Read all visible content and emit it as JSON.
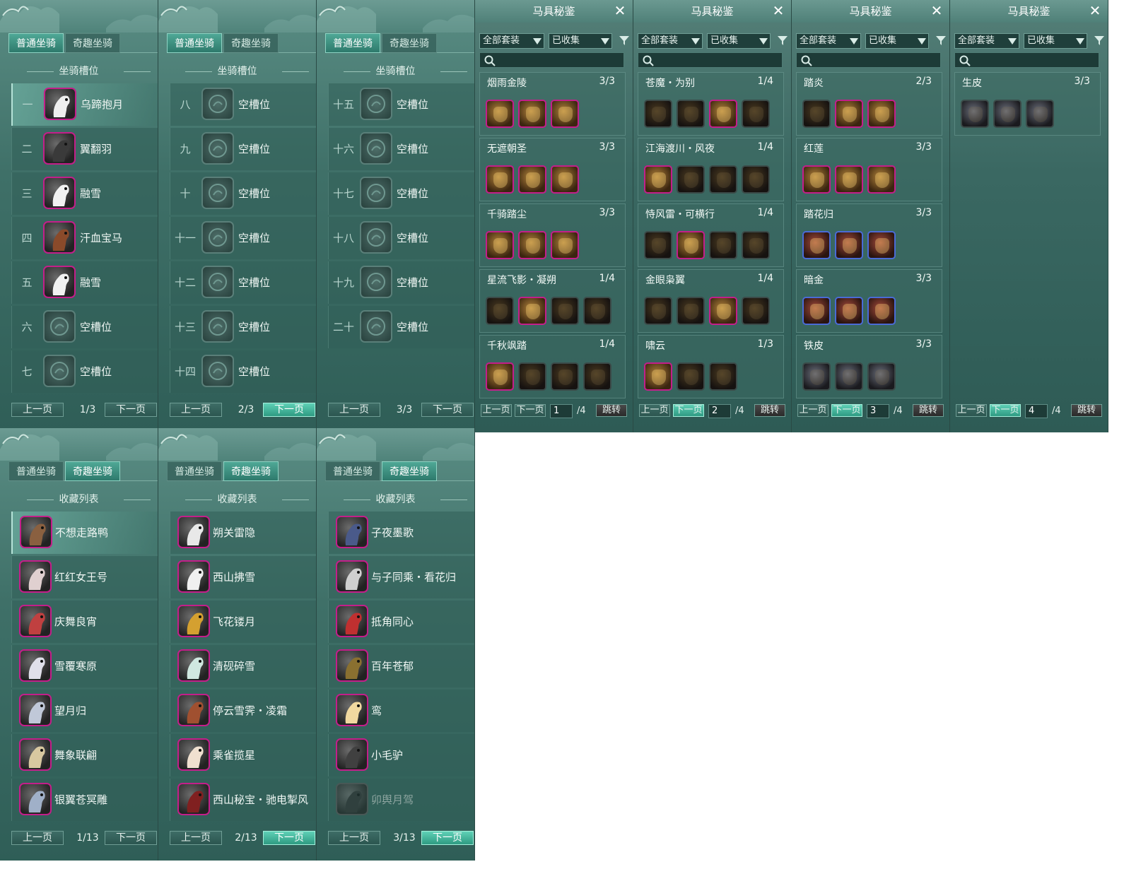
{
  "tabs": {
    "normal": "普通坐骑",
    "fun": "奇趣坐骑"
  },
  "slot_title": "坐骑槽位",
  "collect_title": "收藏列表",
  "buttons": {
    "prev": "上一页",
    "next": "下一页",
    "jump": "跳转"
  },
  "slot_panels": [
    {
      "page": "1/3",
      "rows": [
        {
          "num": "一",
          "name": "乌蹄抱月",
          "empty": false,
          "selected": true
        },
        {
          "num": "二",
          "name": "翼翻羽",
          "empty": false
        },
        {
          "num": "三",
          "name": "融雪",
          "empty": false
        },
        {
          "num": "四",
          "name": "汗血宝马",
          "empty": false
        },
        {
          "num": "五",
          "name": "融雪",
          "empty": false
        },
        {
          "num": "六",
          "name": "空槽位",
          "empty": true
        },
        {
          "num": "七",
          "name": "空槽位",
          "empty": true
        }
      ]
    },
    {
      "page": "2/3",
      "rows": [
        {
          "num": "八",
          "name": "空槽位",
          "empty": true
        },
        {
          "num": "九",
          "name": "空槽位",
          "empty": true
        },
        {
          "num": "十",
          "name": "空槽位",
          "empty": true
        },
        {
          "num": "十一",
          "name": "空槽位",
          "empty": true
        },
        {
          "num": "十二",
          "name": "空槽位",
          "empty": true
        },
        {
          "num": "十三",
          "name": "空槽位",
          "empty": true
        },
        {
          "num": "十四",
          "name": "空槽位",
          "empty": true
        }
      ]
    },
    {
      "page": "3/3",
      "rows": [
        {
          "num": "十五",
          "name": "空槽位",
          "empty": true
        },
        {
          "num": "十六",
          "name": "空槽位",
          "empty": true
        },
        {
          "num": "十七",
          "name": "空槽位",
          "empty": true
        },
        {
          "num": "十八",
          "name": "空槽位",
          "empty": true
        },
        {
          "num": "十九",
          "name": "空槽位",
          "empty": true
        },
        {
          "num": "二十",
          "name": "空槽位",
          "empty": true
        }
      ]
    }
  ],
  "collect_panels": [
    {
      "page": "1/13",
      "items": [
        "不想走路鸭",
        "红红女王号",
        "庆舞良宵",
        "雪覆寒原",
        "望月归",
        "舞象联翩",
        "银翼苍冥雕"
      ]
    },
    {
      "page": "2/13",
      "items": [
        "朔关雷隐",
        "西山拂雪",
        "飞花镂月",
        "清砚碎雪",
        "停云雪霁・凌霜",
        "乘雀揽星",
        "西山秘宝・驰电掣风"
      ]
    },
    {
      "page": "3/13",
      "items": [
        "子夜墨歌",
        "与子同乘・看花归",
        "抵角同心",
        "百年苍郁",
        "鸾",
        "小毛驴",
        "卯舆月驾"
      ]
    }
  ],
  "saddle": {
    "title": "马具秘鉴",
    "filter_all": "全部套装",
    "filter_collected": "已收集",
    "panels": [
      {
        "page": "1",
        "total": "/4",
        "sets": [
          {
            "name": "烟雨金陵",
            "count": "3/3",
            "pieces": [
              "pink",
              "pink",
              "pink"
            ]
          },
          {
            "name": "无遮朝圣",
            "count": "3/3",
            "pieces": [
              "pink",
              "pink",
              "pink"
            ]
          },
          {
            "name": "千骑踏尘",
            "count": "3/3",
            "pieces": [
              "pink",
              "pink",
              "pink"
            ]
          },
          {
            "name": "星流飞影・凝朔",
            "count": "1/4",
            "pieces": [
              "dark",
              "pink",
              "dark",
              "dark"
            ]
          },
          {
            "name": "千秋飒踏",
            "count": "1/4",
            "pieces": [
              "pink",
              "dark",
              "dark",
              "dark"
            ]
          }
        ]
      },
      {
        "page": "2",
        "total": "/4",
        "sets": [
          {
            "name": "苍魔・为别",
            "count": "1/4",
            "pieces": [
              "dark",
              "dark",
              "pink",
              "dark"
            ]
          },
          {
            "name": "江海渡川・风夜",
            "count": "1/4",
            "pieces": [
              "pink",
              "dark",
              "dark",
              "dark"
            ]
          },
          {
            "name": "恃风雷・可横行",
            "count": "1/4",
            "pieces": [
              "dark",
              "pink",
              "dark",
              "dark"
            ]
          },
          {
            "name": "金眼枭翼",
            "count": "1/4",
            "pieces": [
              "dark",
              "dark",
              "pink",
              "dark"
            ]
          },
          {
            "name": "啸云",
            "count": "1/3",
            "pieces": [
              "pink",
              "dark",
              "dark"
            ]
          }
        ]
      },
      {
        "page": "3",
        "total": "/4",
        "sets": [
          {
            "name": "踏炎",
            "count": "2/3",
            "pieces": [
              "dark",
              "pink",
              "pink"
            ]
          },
          {
            "name": "红莲",
            "count": "3/3",
            "pieces": [
              "pink",
              "pink",
              "pink"
            ]
          },
          {
            "name": "踏花归",
            "count": "3/3",
            "pieces": [
              "blue",
              "blue",
              "blue"
            ]
          },
          {
            "name": "暗金",
            "count": "3/3",
            "pieces": [
              "blue",
              "blue",
              "blue"
            ]
          },
          {
            "name": "铁皮",
            "count": "3/3",
            "pieces": [
              "iron",
              "iron",
              "iron"
            ]
          }
        ]
      },
      {
        "page": "4",
        "total": "/4",
        "sets": [
          {
            "name": "生皮",
            "count": "3/3",
            "pieces": [
              "iron",
              "iron",
              "iron"
            ]
          }
        ]
      }
    ]
  }
}
